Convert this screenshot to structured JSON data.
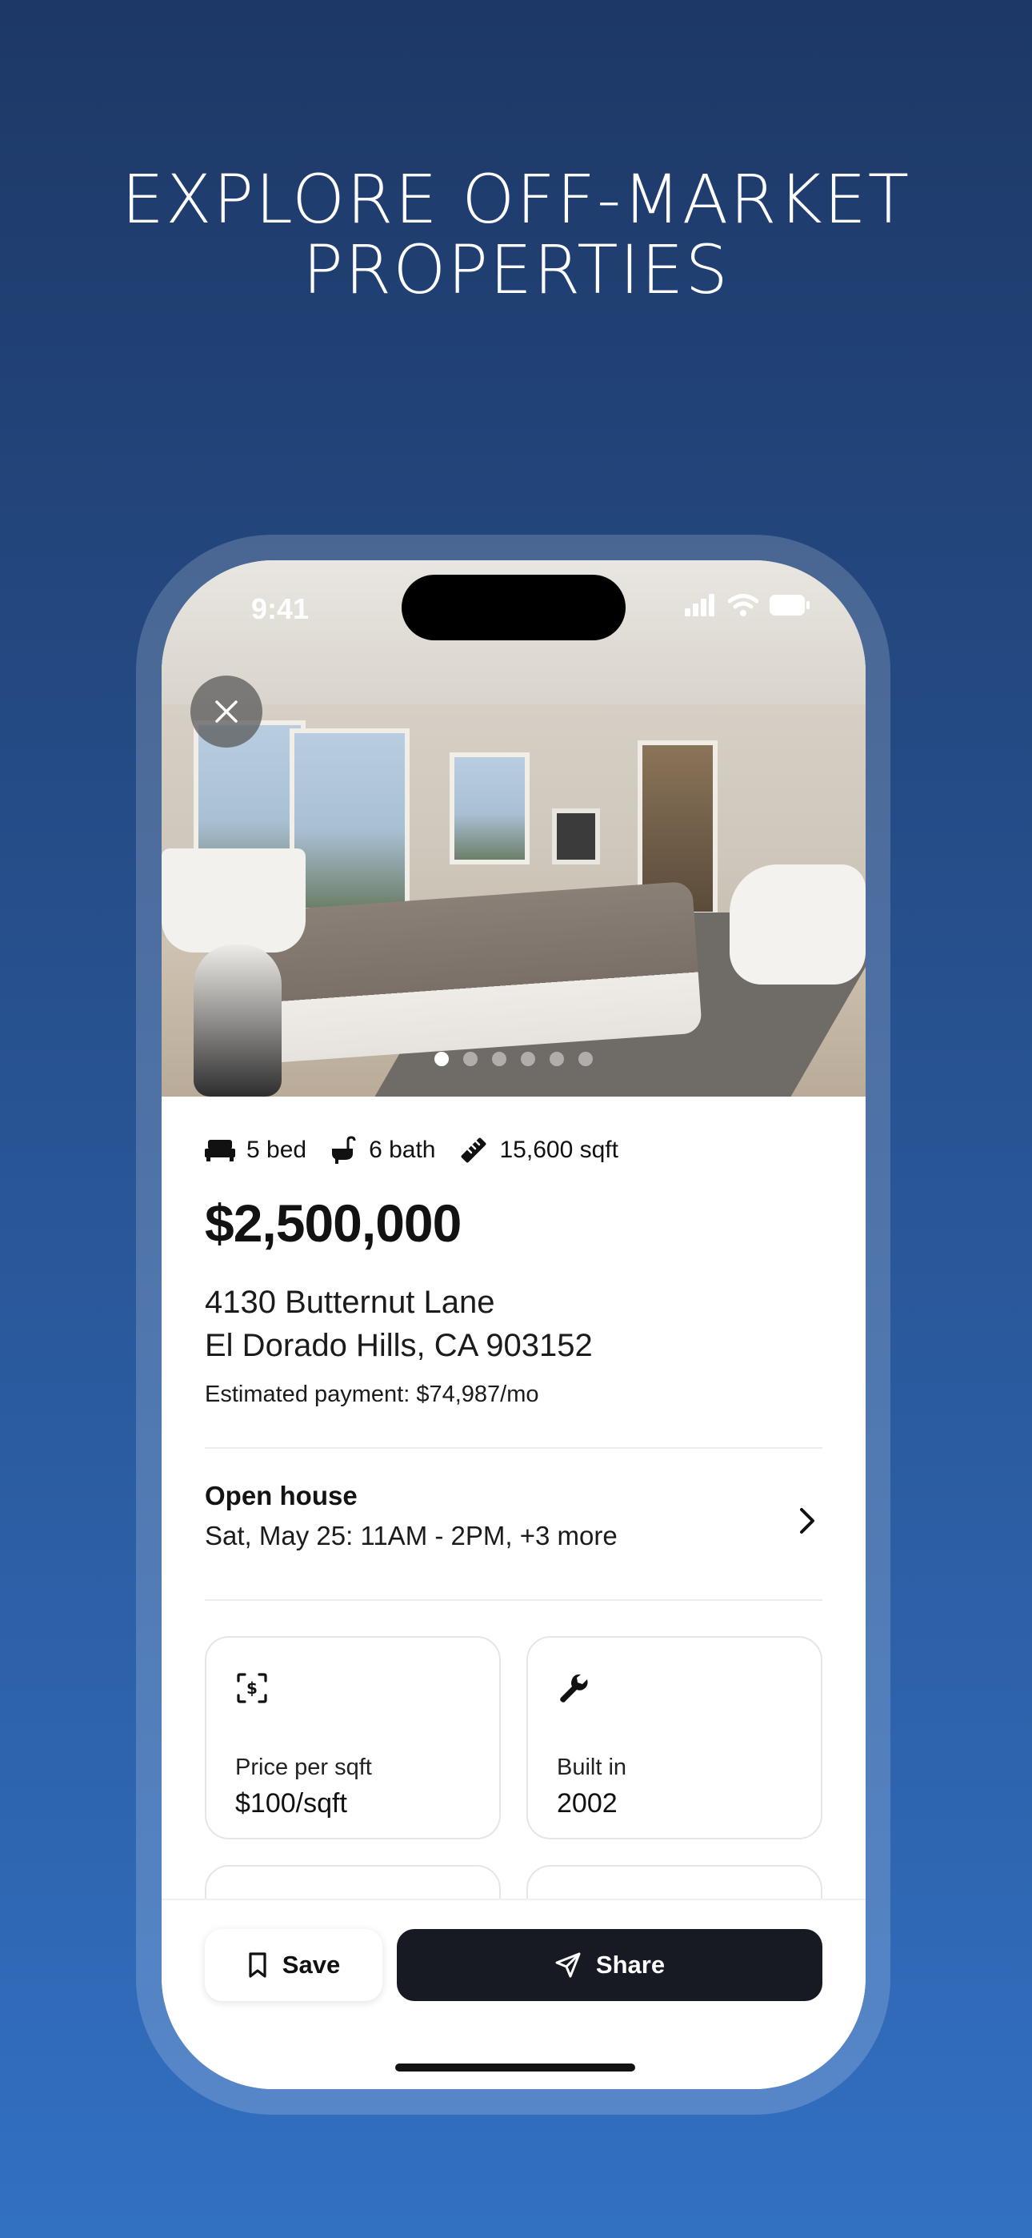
{
  "headline": "EXPLORE OFF-MARKET\nPROPERTIES",
  "status_bar": {
    "time": "9:41"
  },
  "photo": {
    "total_photos": 6,
    "active_photo": 1
  },
  "listing": {
    "beds": "5 bed",
    "baths": "6 bath",
    "sqft": "15,600 sqft",
    "price": "$2,500,000",
    "address_line1": "4130 Butternut Lane",
    "address_line2": "El Dorado Hills, CA 903152",
    "estimated_payment": "Estimated payment: $74,987/mo"
  },
  "open_house": {
    "title": "Open house",
    "times": "Sat, May 25: 11AM - 2PM, +3 more"
  },
  "facts": [
    {
      "label": "Price per sqft",
      "value": "$100/sqft",
      "icon": "price-tag-icon"
    },
    {
      "label": "Built in",
      "value": "2002",
      "icon": "wrench-icon"
    }
  ],
  "actions": {
    "save_label": "Save",
    "share_label": "Share"
  },
  "colors": {
    "accent_dark": "#171a22",
    "background_top": "#1d3866",
    "background_bottom": "#3270c2"
  }
}
